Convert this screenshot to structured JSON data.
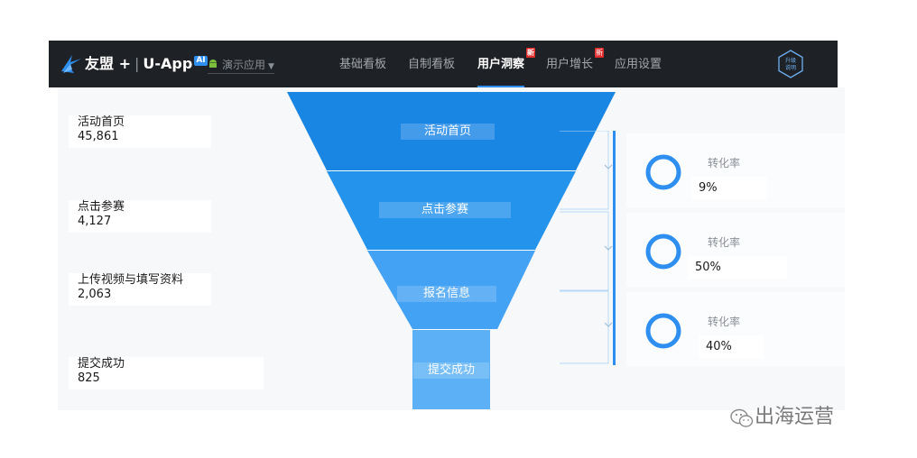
{
  "brand": {
    "name": "友盟",
    "plus": "+",
    "product": "U-App",
    "ai_badge": "AI",
    "app_select": "演示应用"
  },
  "nav": {
    "items": [
      {
        "label": "基础看板",
        "active": false
      },
      {
        "label": "自制看板",
        "active": false
      },
      {
        "label": "用户洞察",
        "active": true,
        "badge": "新"
      },
      {
        "label": "用户增长",
        "active": false,
        "badge": "新"
      },
      {
        "label": "应用设置",
        "active": false
      }
    ],
    "upgrade_line1": "升级",
    "upgrade_line2": "说明"
  },
  "funnel": {
    "steps": [
      {
        "name": "活动首页",
        "count": "45,861"
      },
      {
        "name": "点击参赛",
        "count": "4,127"
      },
      {
        "name": "上传视频与填写资料",
        "count": "2,063"
      },
      {
        "name": "提交成功",
        "count": "825"
      }
    ],
    "labels": [
      "活动首页",
      "点击参赛",
      "报名信息",
      "提交成功"
    ],
    "conversions": [
      {
        "label": "转化率",
        "value": "9%",
        "fraction": 0.09
      },
      {
        "label": "转化率",
        "value": "50%",
        "fraction": 0.5
      },
      {
        "label": "转化率",
        "value": "40%",
        "fraction": 0.4
      }
    ]
  },
  "colors": {
    "nav_bg": "#1e2125",
    "accent": "#2f8ff0",
    "funnel_1": "#1a86e4",
    "funnel_2": "#2493ec",
    "funnel_3": "#43a2f3",
    "funnel_4": "#5bb0f6",
    "badge": "#e02d2d"
  },
  "watermark": "出海运营"
}
